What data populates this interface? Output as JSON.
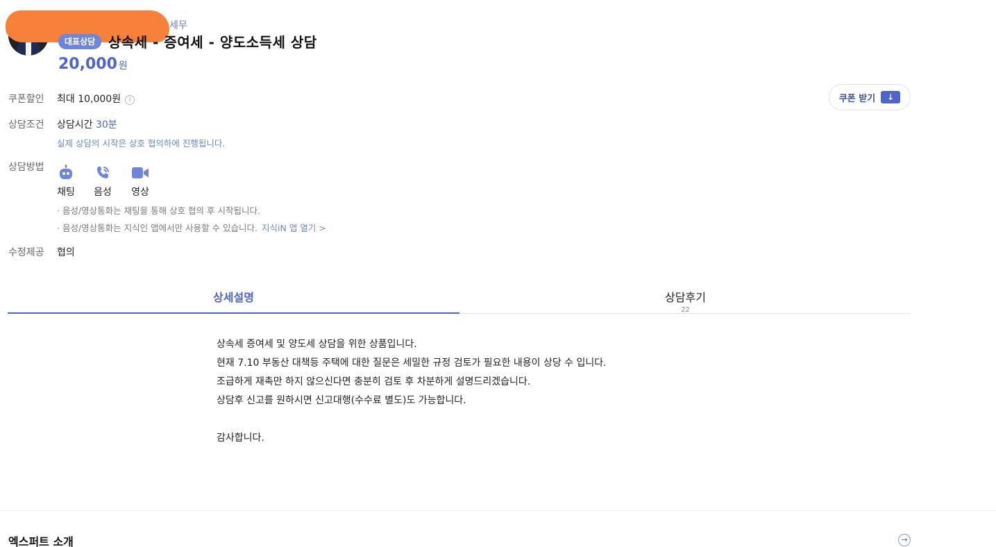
{
  "header": {
    "subname": "세무",
    "badge": "대표상담",
    "title": "상속세 - 증여세 - 양도소득세 상담",
    "price_amount": "20,000",
    "price_unit": "원"
  },
  "coupon": {
    "label": "쿠폰할인",
    "value": "최대 10,000원",
    "info_icon": "i",
    "button_label": "쿠폰 받기",
    "button_icon": "download-icon"
  },
  "condition": {
    "label": "상담조건",
    "time_label": "상담시간",
    "time_value": "30분",
    "note": "실제 상담의 시작은 상호 협의하에 진행됩니다."
  },
  "method": {
    "label": "상담방법",
    "items": [
      {
        "label": "채팅",
        "icon": "chat-bot-icon"
      },
      {
        "label": "음성",
        "icon": "phone-icon"
      },
      {
        "label": "영상",
        "icon": "video-icon"
      }
    ],
    "note1": "· 음성/영상통화는 채팅을 통해 상호 협의 후 시작됩니다.",
    "note2": "· 음성/영상통화는 지식인 앱에서만 사용할 수 있습니다.",
    "app_link": "지식iN 앱 열기 >"
  },
  "revision": {
    "label": "수정제공",
    "value": "협의"
  },
  "tabs": [
    {
      "label": "상세설명",
      "active": true
    },
    {
      "label": "상담후기",
      "count": "22"
    }
  ],
  "description": [
    "상속세 증여세 및 양도세 상담을 위한 상품입니다.",
    "현재 7.10 부동산 대책등 주택에 대한 질문은 세밀한 규정 검토가 필요한 내용이 상당 수 입니다.",
    "조급하게 재촉만 하지 않으신다면 충분히 검토 후 차분하게 설명드리겠습니다.",
    "상담후 신고를 원하시면 신고대행(수수료 별도)도 가능합니다.",
    "",
    "감사합니다."
  ],
  "expert": {
    "title": "엑스퍼트 소개",
    "arrow_icon": "→"
  },
  "colors": {
    "accent": "#4f63cc",
    "badge": "#6f85d8",
    "redaction": "#f5813a"
  }
}
